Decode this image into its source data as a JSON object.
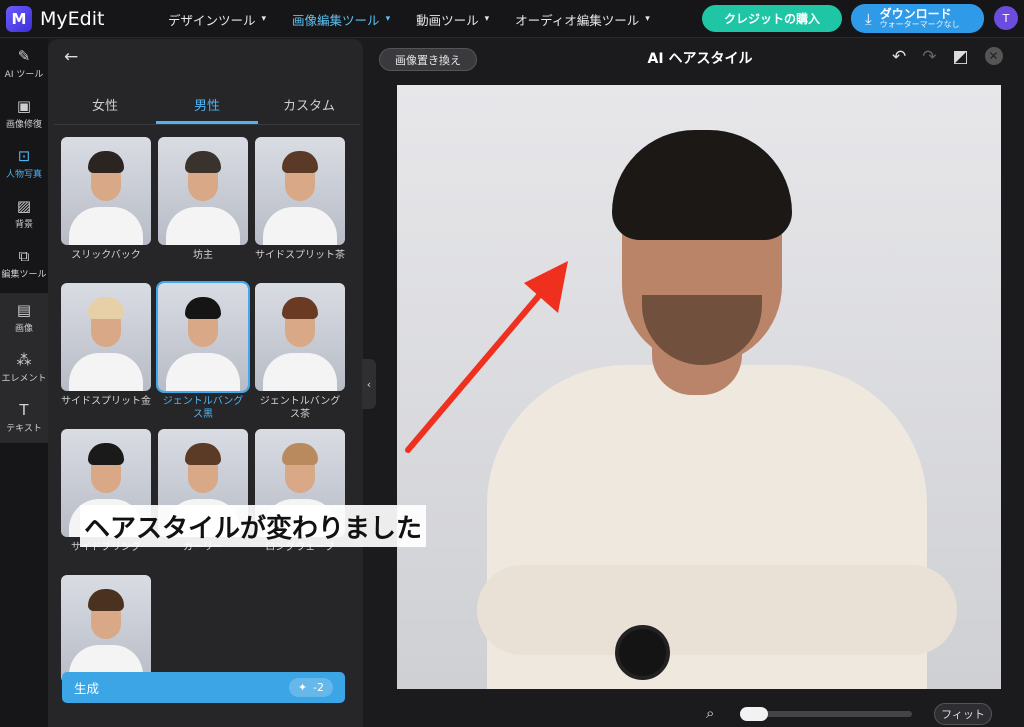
{
  "app": {
    "name": "MyEdit",
    "logo_letter": "M"
  },
  "nav": [
    {
      "label": "デザインツール",
      "active": false
    },
    {
      "label": "画像編集ツール",
      "active": true
    },
    {
      "label": "動画ツール",
      "active": false
    },
    {
      "label": "オーディオ編集ツール",
      "active": false
    }
  ],
  "header": {
    "credit_button": "クレジットの購入",
    "download_button": "ダウンロード",
    "download_sub": "ウォーターマークなし",
    "avatar_initial": "T"
  },
  "tools": [
    {
      "label": "AI ツール",
      "icon": "magic-wand-icon"
    },
    {
      "label": "画像修復",
      "icon": "image-repair-icon"
    },
    {
      "label": "人物写真",
      "icon": "portrait-icon",
      "active": true
    },
    {
      "label": "背景",
      "icon": "background-icon"
    },
    {
      "label": "編集ツール",
      "icon": "edit-tools-icon"
    },
    {
      "label": "画像",
      "icon": "image-icon"
    },
    {
      "label": "エレメント",
      "icon": "elements-icon"
    },
    {
      "label": "テキスト",
      "icon": "text-icon"
    }
  ],
  "panel": {
    "tabs": [
      {
        "label": "女性",
        "active": false
      },
      {
        "label": "男性",
        "active": true
      },
      {
        "label": "カスタム",
        "active": false
      }
    ],
    "styles": [
      {
        "label": "スリックバック",
        "hair": "#2b2420"
      },
      {
        "label": "坊主",
        "hair": "#3a322c"
      },
      {
        "label": "サイドスプリット茶",
        "hair": "#5a3a26"
      },
      {
        "label": "サイドスプリット金",
        "hair": "#e7cfa8"
      },
      {
        "label": "ジェントルバングス黒",
        "hair": "#151515",
        "selected": true
      },
      {
        "label": "ジェントルバングス茶",
        "hair": "#6a3b22"
      },
      {
        "label": "サイドブリング",
        "hair": "#1a1a1a"
      },
      {
        "label": "カーリー",
        "hair": "#5b3b25"
      },
      {
        "label": "ロングウェーブ",
        "hair": "#b98a5e"
      },
      {
        "label": "",
        "hair": "#4a3120"
      }
    ],
    "generate_label": "生成",
    "generate_cost": "-2"
  },
  "editor": {
    "replace_button": "画像置き換え",
    "title": "AI ヘアスタイル",
    "fit_button": "フィット",
    "zoom_value": 0
  },
  "caption": "ヘアスタイルが変わりました",
  "colors": {
    "accent": "#4fb4f0",
    "credit": "#1fc6a6",
    "download": "#2f9be8",
    "arrow": "#f0301f"
  }
}
